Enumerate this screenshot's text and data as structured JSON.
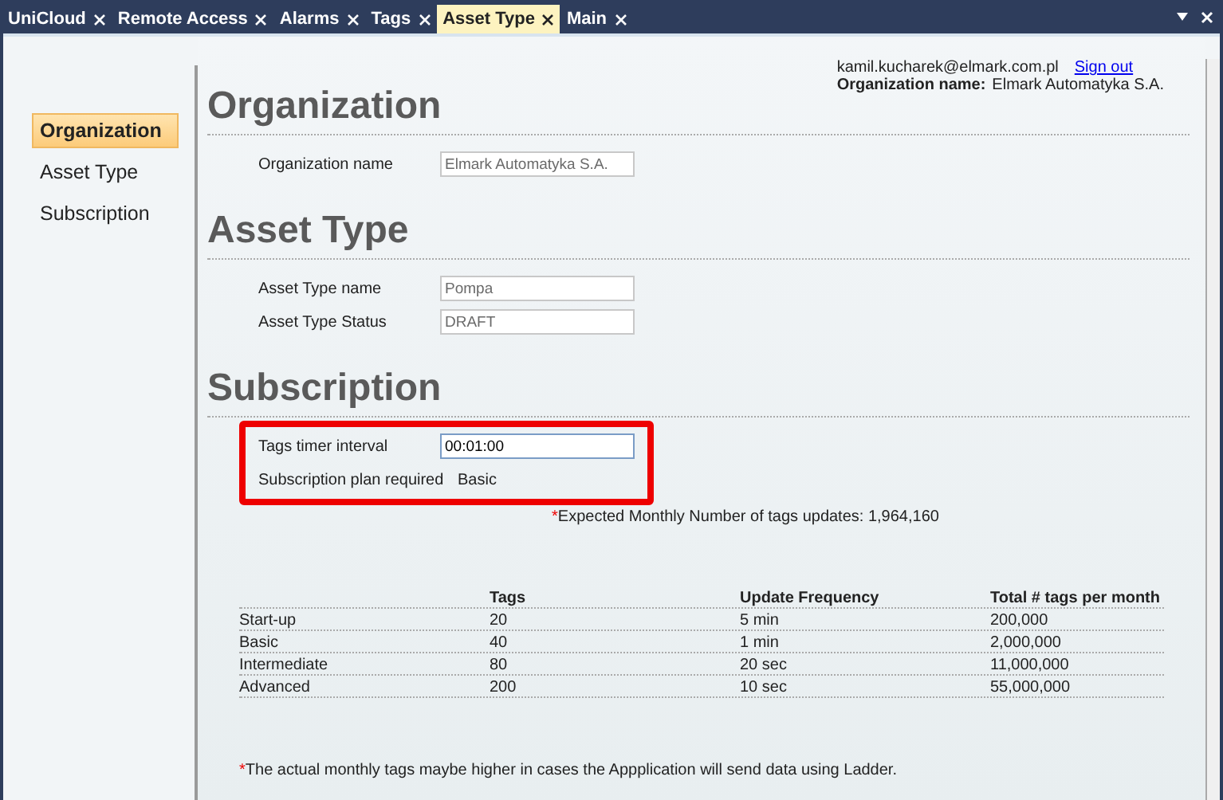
{
  "tabs": [
    {
      "label": "UniCloud",
      "selected": false
    },
    {
      "label": "Remote Access",
      "selected": false
    },
    {
      "label": "Alarms",
      "selected": false
    },
    {
      "label": "Tags",
      "selected": false
    },
    {
      "label": "Asset Type",
      "selected": true
    },
    {
      "label": "Main",
      "selected": false
    }
  ],
  "sidebar": {
    "items": [
      {
        "label": "Organization",
        "selected": true
      },
      {
        "label": "Asset Type",
        "selected": false
      },
      {
        "label": "Subscription",
        "selected": false
      }
    ]
  },
  "account": {
    "email": "kamil.kucharek@elmark.com.pl",
    "sign_out": "Sign out",
    "org_label": "Organization name:",
    "org_value": "Elmark Automatyka S.A."
  },
  "sections": [
    {
      "title": "Organization",
      "highlighted": false,
      "fields": [
        {
          "label": "Organization name",
          "kind": "input",
          "value": "Elmark Automatyka S.A.",
          "disabled": true
        }
      ]
    },
    {
      "title": "Asset Type",
      "highlighted": false,
      "fields": [
        {
          "label": "Asset Type name",
          "kind": "input",
          "value": "Pompa",
          "disabled": true
        },
        {
          "label": "Asset Type Status",
          "kind": "input",
          "value": "DRAFT",
          "disabled": true
        }
      ]
    },
    {
      "title": "Subscription",
      "highlighted": true,
      "fields": [
        {
          "label": "Tags timer interval",
          "kind": "input",
          "value": "00:01:00",
          "disabled": false
        },
        {
          "label": "Subscription plan required",
          "kind": "text",
          "value": "Basic"
        }
      ]
    }
  ],
  "expected": {
    "mark": "*",
    "text": "Expected Monthly Number of tags updates: 1,964,160"
  },
  "table": {
    "columns": [
      "",
      "Tags",
      "Update Frequency",
      "Total # tags per month"
    ],
    "rows": [
      [
        "Start-up",
        "20",
        "5 min",
        "200,000"
      ],
      [
        "Basic",
        "40",
        "1 min",
        "2,000,000"
      ],
      [
        "Intermediate",
        "80",
        "20 sec",
        "11,000,000"
      ],
      [
        "Advanced",
        "200",
        "10 sec",
        "55,000,000"
      ]
    ]
  },
  "footnote": {
    "mark": "*",
    "text": "The actual monthly tags maybe higher in cases the Appplication will send data using Ladder."
  }
}
